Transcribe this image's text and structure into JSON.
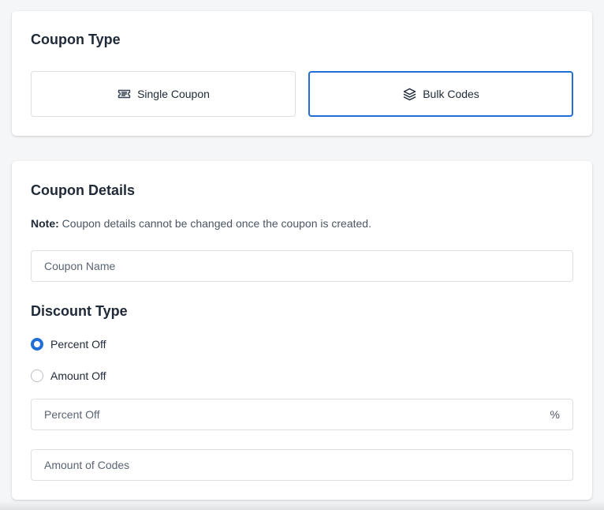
{
  "coupon_type": {
    "title": "Coupon Type",
    "options": [
      {
        "label": "Single Coupon",
        "icon": "ticket-icon",
        "selected": false
      },
      {
        "label": "Bulk Codes",
        "icon": "layers-icon",
        "selected": true
      }
    ]
  },
  "coupon_details": {
    "title": "Coupon Details",
    "note_label": "Note:",
    "note_text": "Coupon details cannot be changed once the coupon is created.",
    "coupon_name_placeholder": "Coupon Name"
  },
  "discount_type": {
    "title": "Discount Type",
    "options": [
      {
        "label": "Percent Off",
        "checked": true
      },
      {
        "label": "Amount Off",
        "checked": false
      }
    ],
    "percent_off_placeholder": "Percent Off",
    "percent_suffix": "%",
    "amount_of_codes_placeholder": "Amount of Codes"
  },
  "colors": {
    "accent": "#1f6fd6",
    "border": "#dcdfe4",
    "background": "#f5f6f8"
  }
}
